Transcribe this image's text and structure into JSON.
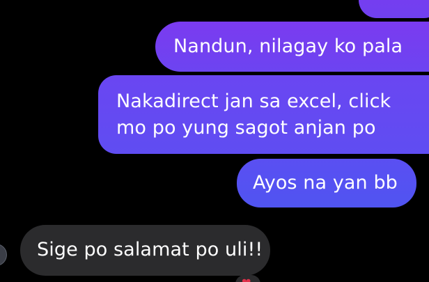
{
  "messages": [
    {
      "id": "m0",
      "sender": "me",
      "text": ""
    },
    {
      "id": "m1",
      "sender": "me",
      "text": "Nandun, nilagay ko pala"
    },
    {
      "id": "m2",
      "sender": "me",
      "lines": [
        "Nakadirect jan sa excel, click",
        "mo po yung sagot anjan po"
      ]
    },
    {
      "id": "m3",
      "sender": "me",
      "text": "Ayos na yan bb"
    },
    {
      "id": "m4",
      "sender": "other",
      "text": "Sige po salamat po uli!!"
    }
  ],
  "reaction": {
    "icon": "heart-icon",
    "glyph": "❤"
  },
  "colors": {
    "background": "#000000",
    "outgoing_start": "#7b3bf0",
    "outgoing_end": "#5054f1",
    "incoming": "#2b2b2d",
    "text": "#ffffff"
  }
}
